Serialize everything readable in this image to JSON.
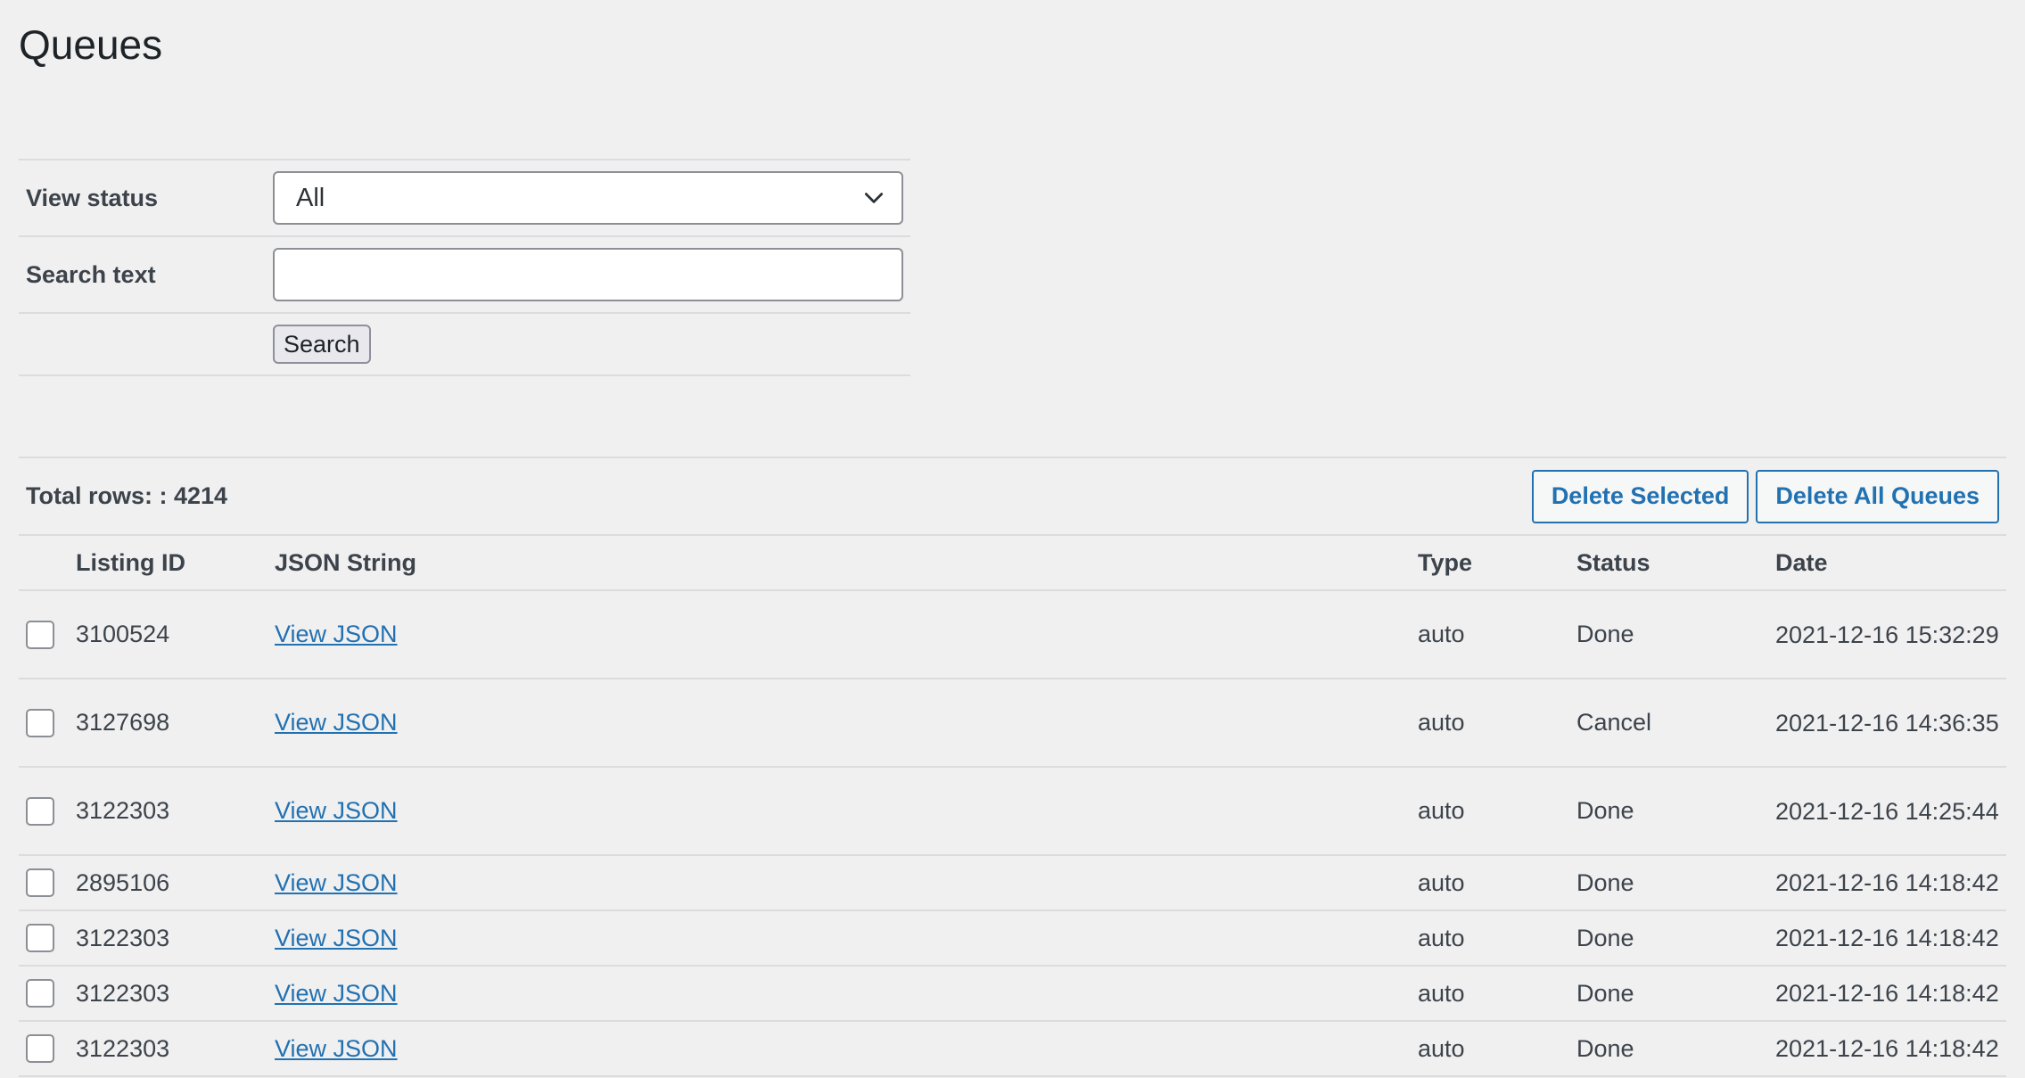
{
  "page": {
    "title": "Queues"
  },
  "filters": {
    "view_status_label": "View status",
    "view_status_value": "All",
    "search_text_label": "Search text",
    "search_text_value": "",
    "search_button": "Search"
  },
  "list": {
    "total_rows_text": "Total rows: : 4214",
    "delete_selected": "Delete Selected",
    "delete_all": "Delete All Queues",
    "columns": [
      "Listing ID",
      "JSON String",
      "Type",
      "Status",
      "Date"
    ],
    "rows": [
      {
        "listing_id": "3100524",
        "json": "View JSON",
        "type": "auto",
        "status": "Done",
        "date": "2021-12-16 15:32:29"
      },
      {
        "listing_id": "3127698",
        "json": "View JSON",
        "type": "auto",
        "status": "Cancel",
        "date": "2021-12-16 14:36:35"
      },
      {
        "listing_id": "3122303",
        "json": "View JSON",
        "type": "auto",
        "status": "Done",
        "date": "2021-12-16 14:25:44"
      },
      {
        "listing_id": "2895106",
        "json": "View JSON",
        "type": "auto",
        "status": "Done",
        "date": "2021-12-16 14:18:42"
      },
      {
        "listing_id": "3122303",
        "json": "View JSON",
        "type": "auto",
        "status": "Done",
        "date": "2021-12-16 14:18:42"
      },
      {
        "listing_id": "3122303",
        "json": "View JSON",
        "type": "auto",
        "status": "Done",
        "date": "2021-12-16 14:18:42"
      },
      {
        "listing_id": "3122303",
        "json": "View JSON",
        "type": "auto",
        "status": "Done",
        "date": "2021-12-16 14:18:42"
      }
    ]
  },
  "colors": {
    "accent": "#2271b1",
    "background": "#f0f0f1",
    "border": "#dcdcde"
  }
}
